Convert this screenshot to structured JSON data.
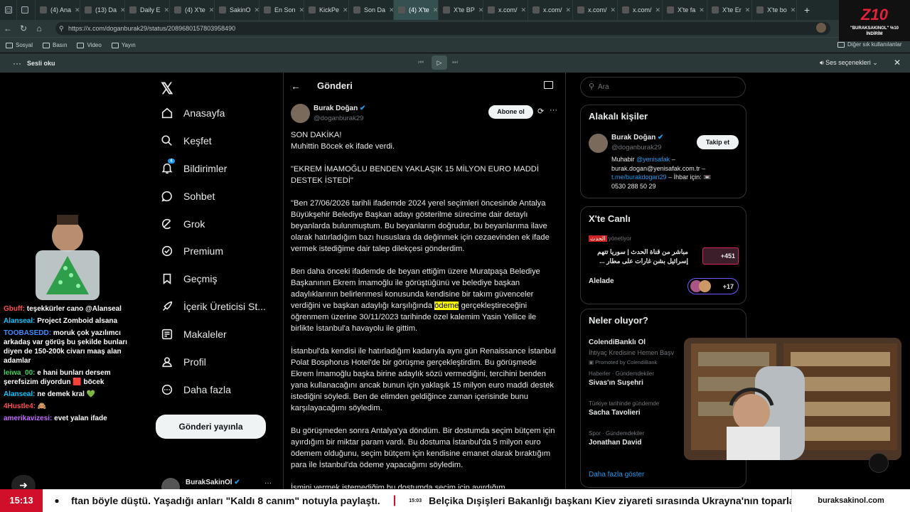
{
  "browser": {
    "tabs": [
      {
        "label": "(4) Ana"
      },
      {
        "label": "(13) Da"
      },
      {
        "label": "Daily E"
      },
      {
        "label": "(4) X'te"
      },
      {
        "label": "SakinO"
      },
      {
        "label": "En Son"
      },
      {
        "label": "KickPe"
      },
      {
        "label": "Son Da"
      },
      {
        "label": "(4) X'te"
      },
      {
        "label": "X'te BP"
      },
      {
        "label": "x.com/"
      },
      {
        "label": "x.com/"
      },
      {
        "label": "x.com/"
      },
      {
        "label": "x.com/"
      },
      {
        "label": "X'te fa"
      },
      {
        "label": "X'te Er"
      },
      {
        "label": "X'te bo"
      }
    ],
    "url": "https://x.com/doganburak29/status/2089680157803958490",
    "bookmarks": [
      "Sosyal",
      "Basın",
      "Video",
      "Yayın"
    ],
    "other_bookmarks": "Diğer sık kullanılanlar",
    "read_aloud": "Sesli oku",
    "voice_options": "Ses seçenekleri"
  },
  "brand_badge": {
    "logo": "Z10",
    "text": "\"BURAKSAKINOL\" %10 İNDİRİM"
  },
  "stream_chat": [
    {
      "user": "Gbuff:",
      "user_color": "#ff4d4d",
      "text": "teşekkürler cano @Alanseal"
    },
    {
      "user": "Alanseal:",
      "user_color": "#00c8ff",
      "text": "Project Zomboid alsana"
    },
    {
      "user": "TOOBASEDD:",
      "user_color": "#3c8cff",
      "text": "moruk çok yazılımcı arkadaş var görüş bu şekilde bunları diyen de 150-200k civarı maaş alan adamlar"
    },
    {
      "user": "leiwa_00:",
      "user_color": "#3fd15f",
      "text": "e hani bunları dersem şerefsizim diyordun 🟥 böcek"
    },
    {
      "user": "Alanseal:",
      "user_color": "#00c8ff",
      "text": "ne demek kral 💚"
    },
    {
      "user": "4Hustle4:",
      "user_color": "#ff4d4d",
      "text": "🙈"
    },
    {
      "user": "amerikavizesi:",
      "user_color": "#c46cff",
      "text": "evet yalan ifade"
    }
  ],
  "x_nav": {
    "items": [
      {
        "label": "Anasayfa",
        "icon": "home-icon"
      },
      {
        "label": "Keşfet",
        "icon": "search-icon"
      },
      {
        "label": "Bildirimler",
        "icon": "bell-icon",
        "badge": "4"
      },
      {
        "label": "Sohbet",
        "icon": "chat-icon"
      },
      {
        "label": "Grok",
        "icon": "grok-icon"
      },
      {
        "label": "Premium",
        "icon": "premium-icon"
      },
      {
        "label": "Geçmiş",
        "icon": "bookmark-icon"
      },
      {
        "label": "İçerik Üreticisi St...",
        "icon": "rocket-icon"
      },
      {
        "label": "Makaleler",
        "icon": "article-icon"
      },
      {
        "label": "Profil",
        "icon": "profile-icon"
      },
      {
        "label": "Daha fazla",
        "icon": "more-icon"
      }
    ],
    "post_button": "Gönderi yayınla",
    "account_name": "BurakSakinOl"
  },
  "post": {
    "header": "Gönderi",
    "author_name": "Burak Doğan",
    "author_handle": "@doganburak29",
    "follow_label": "Abone ol",
    "paragraphs": [
      "SON DAKİKA!\nMuhittin Böcek ek ifade verdi.",
      "\"EKREM İMAMOĞLU BENDEN YAKLAŞIK 15 MİLYON EURO MADDİ DESTEK İSTEDİ\"",
      "\"Ben 27/06/2026 tarihli ifademde 2024 yerel seçimleri öncesinde Antalya Büyükşehir Belediye Başkan adayı gösterilme sürecime dair detaylı beyanlarda bulunmuştum. Bu beyanlarım doğrudur, bu beyanlarıma ilave olarak hatırladığım bazı hususlara da değinmek için cezaevinden ek ifade vermek istediğime dair talep dilekçesi gönderdim.",
      "Ben daha önceki ifademde de beyan ettiğim üzere Muratpaşa Belediye Başkanının Ekrem İmamoğlu ile görüştüğünü ve belediye başkan adaylıklarının belirlenmesi konusunda kendisine bir takım güvenceler verdiğini ve başkan adaylığı karşılığında ödeme gerçekleştireceğini öğrenmem üzerine 30/11/2023 tarihinde özel kalemim Yasin Yellice ile birlikte İstanbul'a havayolu ile gittim.",
      "İstanbul'da kendisi ile hatırladığım kadarıyla aynı gün Renaissance İstanbul Polat Bosphorus Hotel'de bir görüşme gerçekleştirdim. Bu görüşmede Ekrem İmamoğlu başka birine adaylık sözü vermediğini, tercihini benden yana kullanacağını ancak bunun için yaklaşık 15 milyon euro maddi destek istediğini söyledi. Ben de elimden geldiğince zaman içerisinde bunu karşılayacağımı söyledim.",
      "Bu görüşmeden sonra Antalya'ya döndüm. Bir dostumda seçim bütçem için ayırdığım bir miktar param vardı. Bu dostuma İstanbul'da 5 milyon euro ödemem olduğunu, seçim bütçem için kendisine emanet olarak bıraktığım para ile İstanbul'da ödeme yapacağımı söyledim.",
      "İsmini vermek istemediğim bu dostumda seçim için ayırdığım"
    ],
    "highlight_word": "ödeme",
    "highlight_color": "#ffff00"
  },
  "sidebar": {
    "search_placeholder": "Ara",
    "related_title": "Alakalı kişiler",
    "related_name": "Burak Doğan",
    "related_handle": "@doganburak29",
    "follow_label": "Takip et",
    "bio_prefix": "Muhabir ",
    "bio_mention": "@yenisafak",
    "bio_rest": " – burak.dogan@yenisafak.com.tr –",
    "bio_link": "t.me/burakdogan29",
    "bio_tail": " – İhbar için: 📼",
    "bio_phone": "0530 288 50 29",
    "live_title": "X'te Canlı",
    "live_channel": "الحدث",
    "live_status": "yönetiyor",
    "live_text": "مباشر من قناة الحدث | سوريا تتهم إسرائيل بشن غارات على مطار ...",
    "live_count": "+451",
    "live2_title": "Alelade",
    "live2_count": "+17",
    "trends_title": "Neler oluyor?",
    "promo_name": "ColendiBanklı Ol",
    "promo_text": "İhtiyaç Kredisine Hemen Başv",
    "promo_label": "Promoted by ColendiBank",
    "trends": [
      {
        "context": "Haberler · Gündemdekiler",
        "name": "Sivas'ın Suşehri"
      },
      {
        "context": "Türkiye tarihinde gündemde",
        "name": "Sacha Tavolieri"
      },
      {
        "context": "Spor · Gündemdekiler",
        "name": "Jonathan David"
      }
    ],
    "show_more": "Daha fazla göster"
  },
  "ticker": {
    "time": "15:13",
    "text1": "ftan böyle düştü. Yaşadığı anları \"Kaldı 8 canım\" notuyla paylaştı.",
    "time2": "15:03",
    "text2": "Belçika Dışişleri Bakanlığı başkanı Kiev ziyareti sırasında Ukrayna'nın toparlanm",
    "site": "buraksakinol.com",
    "accent": "#d0102a"
  },
  "colors": {
    "x_blue": "#1d9bf0",
    "bg": "#000000",
    "border": "#2f3336"
  }
}
